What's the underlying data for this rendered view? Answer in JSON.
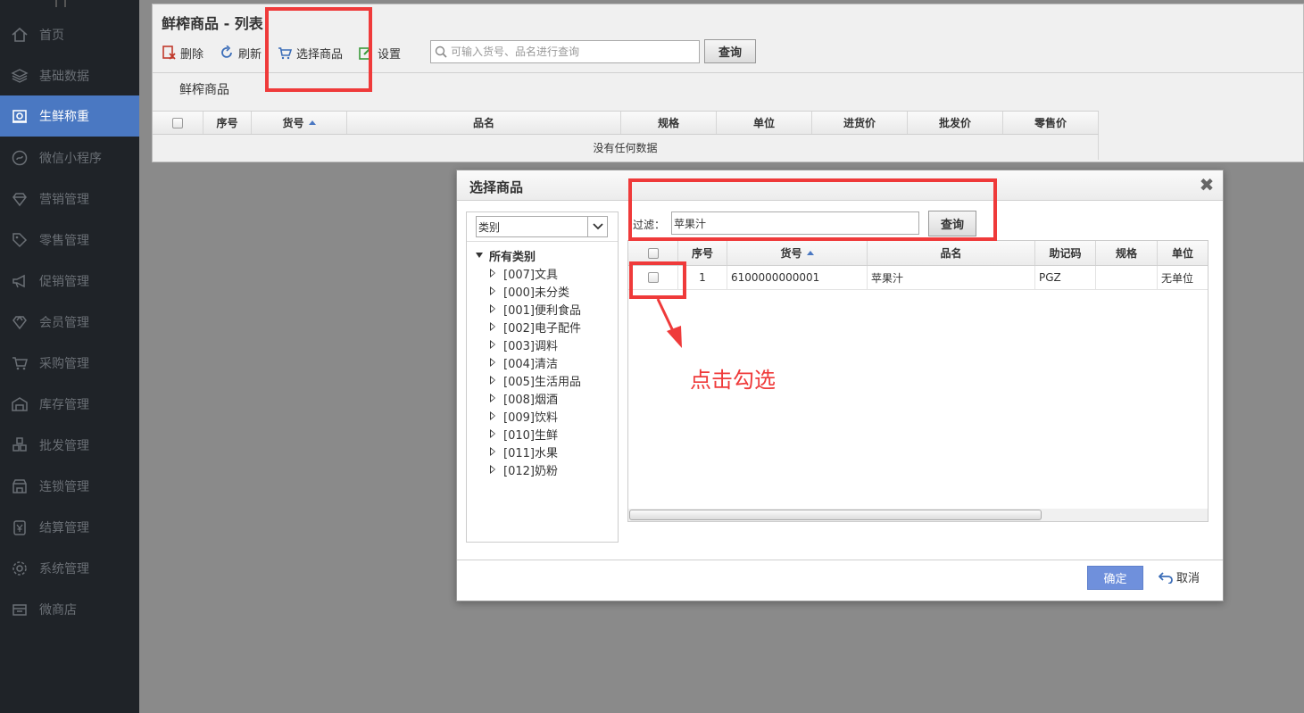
{
  "sidebar": {
    "items": [
      {
        "label": "首页",
        "icon": "home-icon"
      },
      {
        "label": "基础数据",
        "icon": "layers-icon"
      },
      {
        "label": "生鲜称重",
        "icon": "scale-icon",
        "active": true
      },
      {
        "label": "微信小程序",
        "icon": "miniprogram-icon"
      },
      {
        "label": "营销管理",
        "icon": "diamond-icon"
      },
      {
        "label": "零售管理",
        "icon": "tag-icon"
      },
      {
        "label": "促销管理",
        "icon": "megaphone-icon"
      },
      {
        "label": "会员管理",
        "icon": "gem-icon"
      },
      {
        "label": "采购管理",
        "icon": "cart-icon"
      },
      {
        "label": "库存管理",
        "icon": "warehouse-icon"
      },
      {
        "label": "批发管理",
        "icon": "cubes-icon"
      },
      {
        "label": "连锁管理",
        "icon": "store-icon"
      },
      {
        "label": "结算管理",
        "icon": "yen-icon"
      },
      {
        "label": "系统管理",
        "icon": "gear-icon"
      },
      {
        "label": "微商店",
        "icon": "shop-icon"
      }
    ]
  },
  "main": {
    "title": "鲜榨商品 - 列表",
    "toolbar": {
      "delete_label": "删除",
      "refresh_label": "刷新",
      "select_label": "选择商品",
      "settings_label": "设置",
      "search_placeholder": "可输入货号、品名进行查询",
      "query_label": "查询"
    },
    "subtab": "鲜榨商品",
    "grid": {
      "columns": [
        "序号",
        "货号",
        "品名",
        "规格",
        "单位",
        "进货价",
        "批发价",
        "零售价"
      ],
      "empty_text": "没有任何数据"
    }
  },
  "dialog": {
    "title": "选择商品",
    "category_select": "类别",
    "tree": {
      "root": "所有类别",
      "nodes": [
        "[007]文具",
        "[000]未分类",
        "[001]便利食品",
        "[002]电子配件",
        "[003]调料",
        "[004]清洁",
        "[005]生活用品",
        "[008]烟酒",
        "[009]饮料",
        "[010]生鲜",
        "[011]水果",
        "[012]奶粉"
      ]
    },
    "filter_label": "过滤：",
    "filter_value": "苹果汁",
    "query_label": "查询",
    "results": {
      "columns": [
        "序号",
        "货号",
        "品名",
        "助记码",
        "规格",
        "单位"
      ],
      "rows": [
        {
          "seq": "1",
          "code": "6100000000001",
          "name": "苹果汁",
          "mnemonic": "PGZ",
          "spec": "",
          "unit": "无单位"
        }
      ]
    },
    "ok_label": "确定",
    "cancel_label": "取消"
  },
  "annotation": {
    "text": "点击勾选",
    "color": "#ef3a3a"
  }
}
